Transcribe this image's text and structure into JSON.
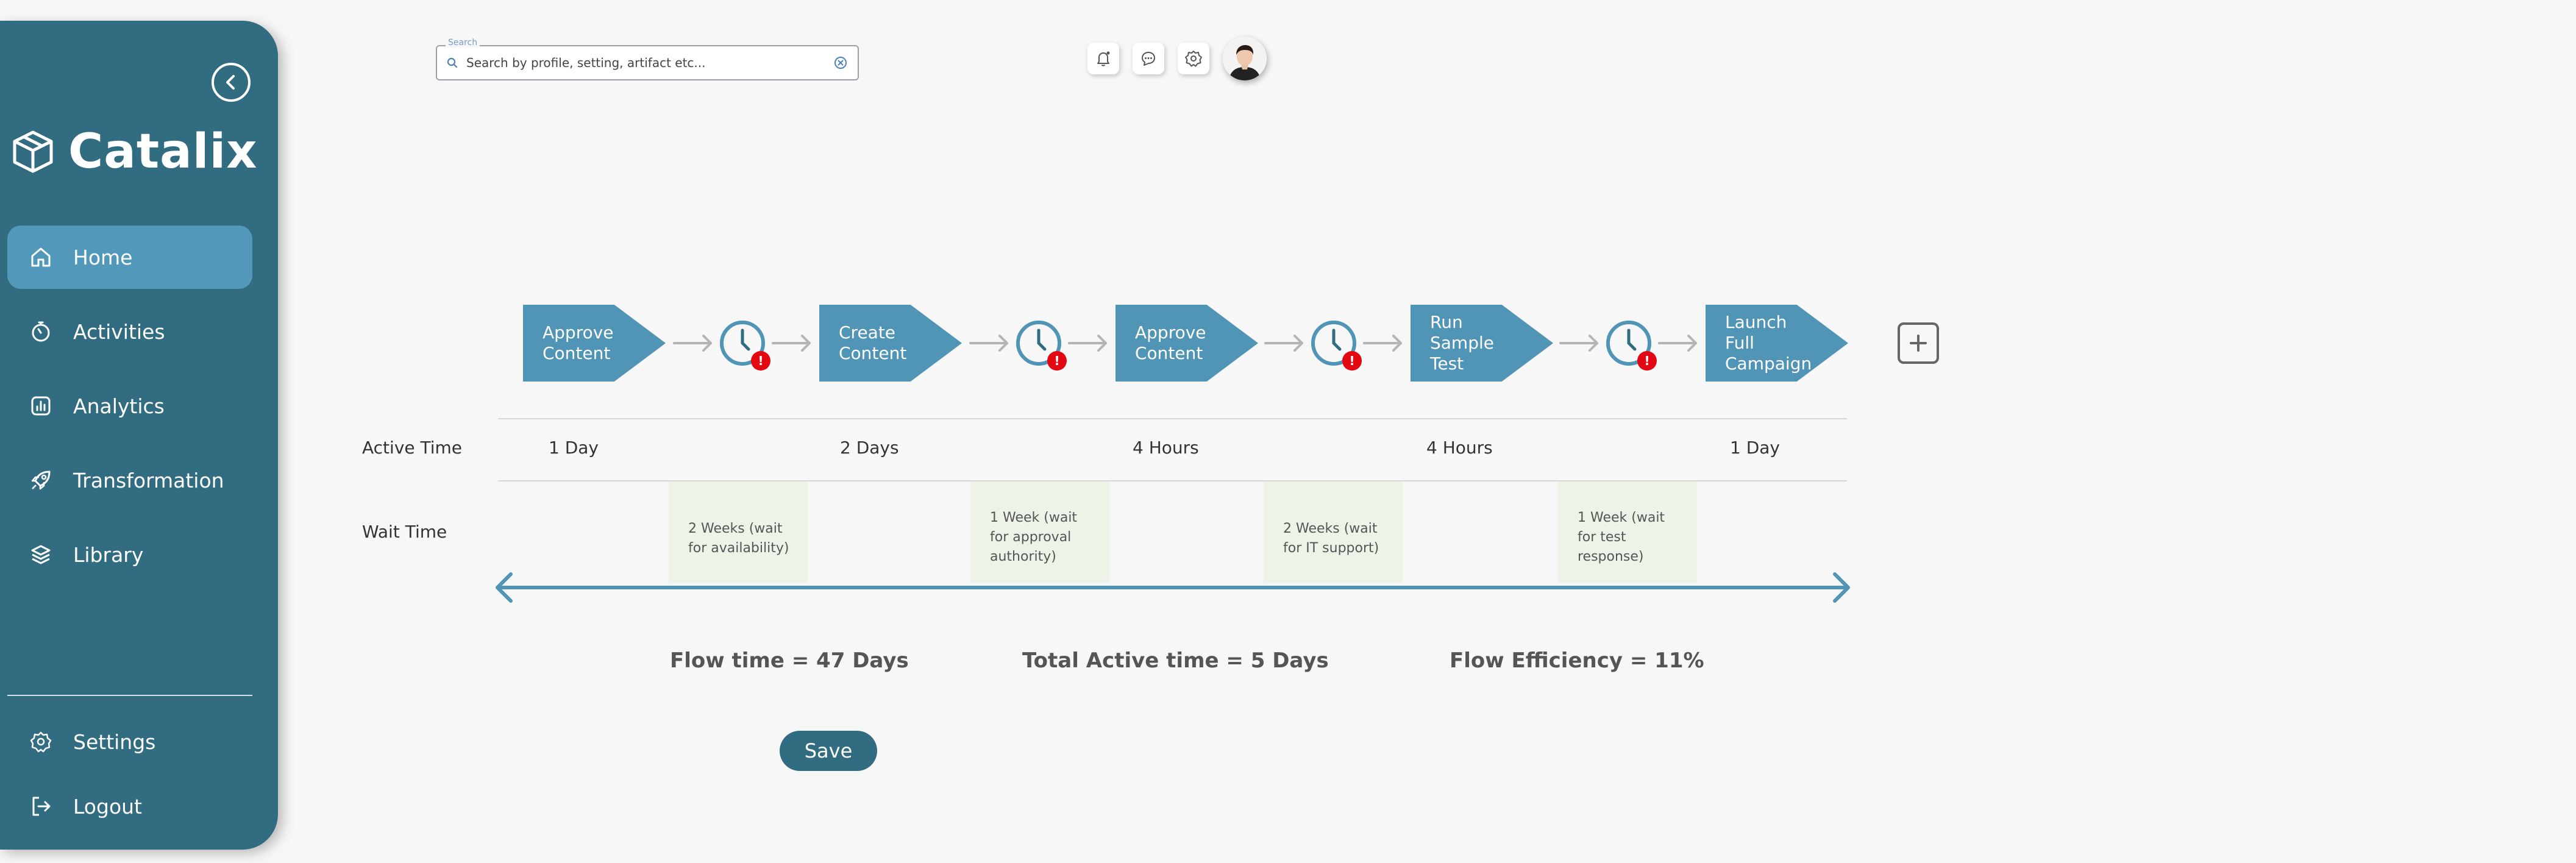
{
  "brand": {
    "name": "Catalix"
  },
  "sidebar": {
    "items": [
      {
        "label": "Home",
        "icon": "home-icon",
        "active": true
      },
      {
        "label": "Activities",
        "icon": "stopwatch-icon"
      },
      {
        "label": "Analytics",
        "icon": "chart-icon"
      },
      {
        "label": "Transformation",
        "icon": "rocket-icon"
      },
      {
        "label": "Library",
        "icon": "layers-icon"
      }
    ],
    "bottom_items": [
      {
        "label": "Settings",
        "icon": "gear-icon"
      },
      {
        "label": "Logout",
        "icon": "logout-icon"
      }
    ]
  },
  "header": {
    "search": {
      "legend": "Search",
      "placeholder": "Search by profile, setting, artifact etc..."
    },
    "icons": [
      "bell-icon",
      "chat-icon",
      "gear-icon"
    ]
  },
  "flow": {
    "steps": [
      {
        "label": "Approve Content"
      },
      {
        "label": "Create Content"
      },
      {
        "label": "Approve Content"
      },
      {
        "label": "Run Sample Test"
      },
      {
        "label": "Launch Full Campaign"
      }
    ],
    "wait_marker": "!"
  },
  "timeline": {
    "active_label": "Active Time",
    "wait_label": "Wait Time",
    "active_times": [
      "1 Day",
      "2 Days",
      "4 Hours",
      "4 Hours",
      "1 Day"
    ],
    "wait_times": [
      "2 Weeks (wait for availability)",
      "1 Week (wait for approval authority)",
      "2 Weeks (wait for IT support)",
      "1 Week (wait for test response)"
    ]
  },
  "metrics": {
    "flow_time": "Flow time = 47 Days",
    "active_time": "Total Active time = 5 Days",
    "efficiency": "Flow Efficiency = 11%"
  },
  "actions": {
    "save_label": "Save",
    "add_symbol": "+"
  },
  "colors": {
    "sidebar": "#316c80",
    "active_nav": "#5298bb",
    "step": "#5094b6",
    "alert": "#e30613",
    "wait_bg": "#eef3e8"
  }
}
